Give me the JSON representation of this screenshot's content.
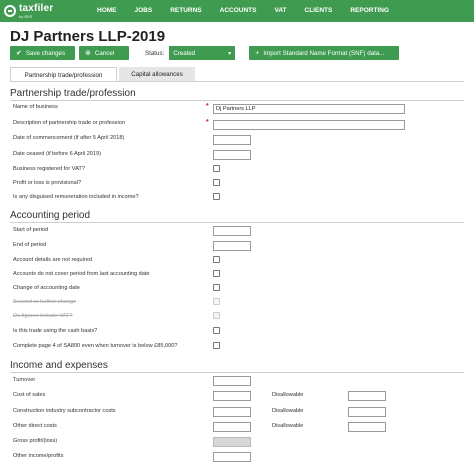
{
  "brand": {
    "name": "taxfiler",
    "sub": "by IRIS"
  },
  "nav": [
    "HOME",
    "JOBS",
    "RETURNS",
    "ACCOUNTS",
    "VAT",
    "CLIENTS",
    "REPORTING"
  ],
  "page_title": "DJ Partners LLP-2019",
  "toolbar": {
    "save_label": "Save changes",
    "cancel_label": "Cancel",
    "status_label": "Status:",
    "status_value": "Created",
    "import_label": "Import Standard Name Format (SNF) data..."
  },
  "tabs": [
    "Partnership trade/profession",
    "Capital allowances"
  ],
  "section1": {
    "title": "Partnership trade/profession",
    "name_label": "Name of business",
    "name_value": "Dj Partners LLP",
    "desc_label": "Description of partnership trade or profession",
    "commence_label": "Date of commencement (if after 5 April 2018)",
    "ceased_label": "Date ceased (if before 6 April 2019)",
    "vat_label": "Business registered for VAT?",
    "provisional_label": "Profit or loss is provisional?",
    "disguised_label": "Is any disguised remuneration included in income?"
  },
  "section2": {
    "title": "Accounting period",
    "start_label": "Start of period",
    "end_label": "End of period",
    "not_required_label": "Account details are not required",
    "not_cover_label": "Accounts do not cover period from last accounting date",
    "change_label": "Change of accounting date",
    "second_label": "Second or further change",
    "vat_figures_label": "Do figures include VAT?",
    "cash_label": "Is this trade using the cash basis?",
    "page4_label": "Complete page 4 of SA800 even when turnover is below £85,000?"
  },
  "section3": {
    "title": "Income and expenses",
    "turnover_label": "Turnover",
    "cost_label": "Cost of sales",
    "cis_label": "Construction industry subcontractor costs",
    "other_direct_label": "Other direct costs",
    "gross_label": "Gross profit/(loss)",
    "other_income_label": "Other income/profits",
    "disallowable_label": "Disallowable"
  },
  "colors": {
    "brand_green": "#3f9b50",
    "required_red": "#d42020"
  },
  "icons": {
    "save": "check-icon",
    "cancel": "cancel-icon",
    "status": "chevron-down-icon",
    "import": "plus-icon"
  }
}
